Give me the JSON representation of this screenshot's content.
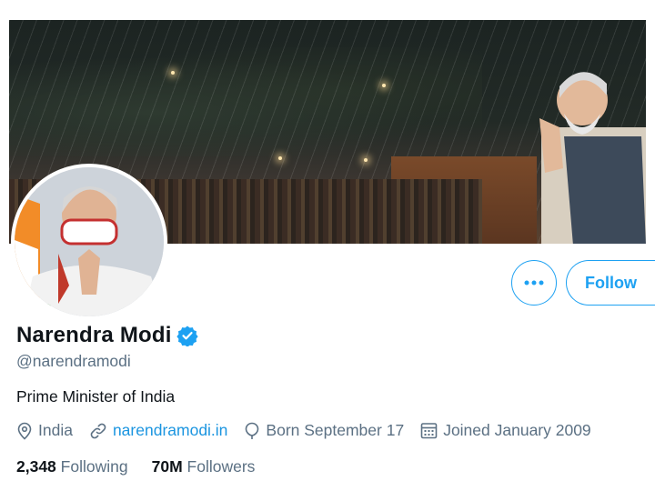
{
  "profile": {
    "name": "Narendra Modi",
    "handle": "@narendramodi",
    "bio": "Prime Minister of India",
    "verified": true
  },
  "meta": {
    "location": "India",
    "website": "narendramodi.in",
    "born": "Born September 17",
    "joined": "Joined January 2009"
  },
  "stats": {
    "following_count": "2,348",
    "following_label": "Following",
    "followers_count": "70M",
    "followers_label": "Followers"
  },
  "actions": {
    "more_label": "•••",
    "follow_label": "Follow"
  },
  "colors": {
    "accent": "#1da1f2",
    "link": "#1b95e0",
    "secondary_text": "#5b7083",
    "primary_text": "#0f1419"
  },
  "icons": [
    "more-icon",
    "verified-badge-icon",
    "location-icon",
    "link-icon",
    "birthday-balloon-icon",
    "calendar-icon"
  ]
}
